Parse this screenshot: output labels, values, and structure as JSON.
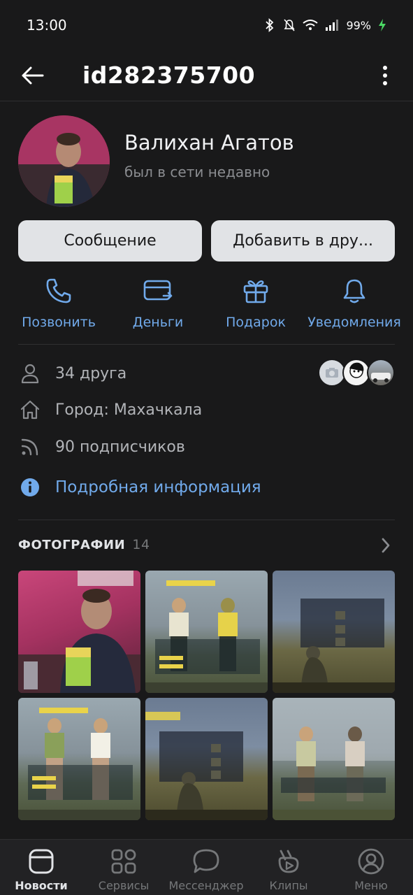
{
  "status_bar": {
    "time": "13:00",
    "battery": "99%"
  },
  "header": {
    "title": "id282375700"
  },
  "profile": {
    "name": "Валихан Агатов",
    "status": "был в сети недавно"
  },
  "buttons": {
    "message": "Сообщение",
    "add_friend": "Добавить в дру..."
  },
  "actions": [
    {
      "label": "Позвонить",
      "icon": "phone-icon"
    },
    {
      "label": "Деньги",
      "icon": "money-card-icon"
    },
    {
      "label": "Подарок",
      "icon": "gift-icon"
    },
    {
      "label": "Уведомления",
      "icon": "bell-icon"
    }
  ],
  "info": {
    "friends": "34 друга",
    "city": "Город: Махачкала",
    "followers": "90 подписчиков",
    "more": "Подробная информация"
  },
  "photos": {
    "title": "ФОТОГРАФИИ",
    "count": "14"
  },
  "tabbar": [
    {
      "label": "Новости",
      "icon": "news-icon",
      "active": true
    },
    {
      "label": "Сервисы",
      "icon": "services-icon",
      "active": false
    },
    {
      "label": "Мессенджер",
      "icon": "messenger-icon",
      "active": false
    },
    {
      "label": "Клипы",
      "icon": "clips-icon",
      "active": false
    },
    {
      "label": "Меню",
      "icon": "profile-menu-icon",
      "active": false
    }
  ],
  "colors": {
    "accent": "#71aaeb",
    "background": "#19191a",
    "button": "#e1e3e6"
  }
}
